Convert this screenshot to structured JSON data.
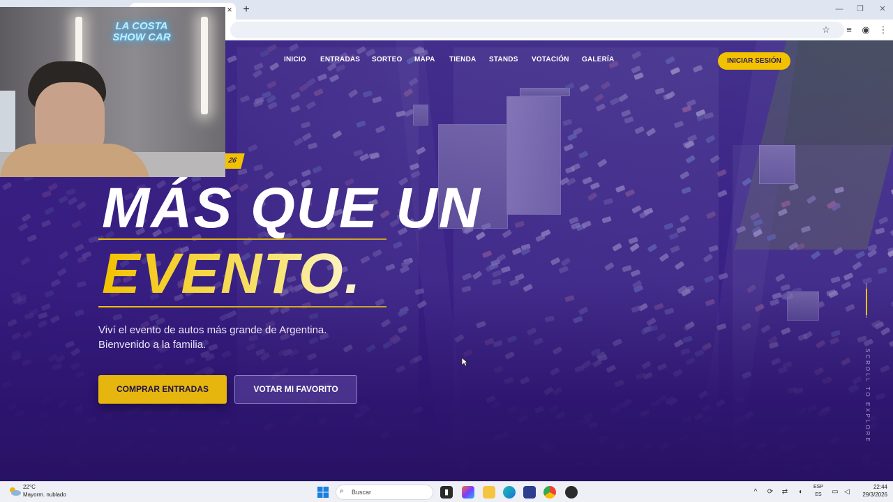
{
  "browser": {
    "tab_close": "×",
    "new_tab": "+",
    "controls": {
      "minimize": "—",
      "restore": "❐",
      "close": "✕"
    },
    "toolbar_icons": {
      "bookmark": "☆",
      "media": "≡",
      "profile": "◉",
      "menu": "⋮"
    }
  },
  "site": {
    "nav": [
      "INICIO",
      "ENTRADAS",
      "SORTEO",
      "MAPA",
      "TIENDA",
      "STANDS",
      "VOTACIÓN",
      "GALERÍA"
    ],
    "login": "INICIAR SESIÓN",
    "badge": "26",
    "headline_1": "MÁS QUE UN",
    "headline_2": "EVENTO.",
    "subtitle_1": "Viví el evento de autos más grande de Argentina.",
    "subtitle_2": "Bienvenido a la familia.",
    "cta_primary": "COMPRAR ENTRADAS",
    "cta_secondary": "VOTAR MI FAVORITO",
    "scroll_hint": "SCROLL TO EXPLORE",
    "colors": {
      "accent": "#f2c200",
      "background": "#36207f",
      "headline": "#ffffff"
    }
  },
  "webcam": {
    "neon_sign_line1": "LA COSTA",
    "neon_sign_line2": "SHOW CAR"
  },
  "taskbar": {
    "weather_temp": "22°C",
    "weather_condition": "Mayorm. nublado",
    "search_placeholder": "Buscar",
    "lang_1": "ESP",
    "lang_2": "ES",
    "time": "22:44",
    "date": "29/3/2026",
    "tray_icons": {
      "chevron": "^",
      "network": "⇄",
      "volume": "🔊",
      "battery": "▭"
    }
  }
}
